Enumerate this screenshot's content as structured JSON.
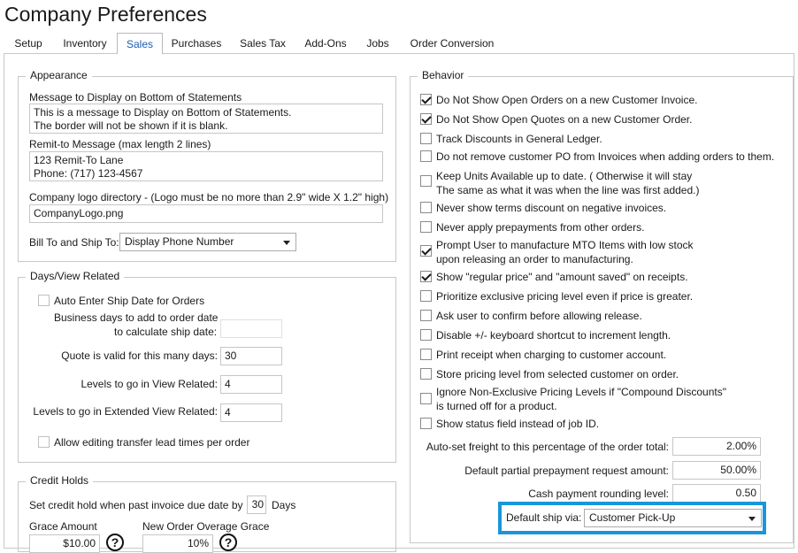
{
  "window": {
    "title": "Company Preferences"
  },
  "tabs": [
    {
      "label": "Setup"
    },
    {
      "label": "Inventory"
    },
    {
      "label": "Sales"
    },
    {
      "label": "Purchases"
    },
    {
      "label": "Sales Tax"
    },
    {
      "label": "Add-Ons"
    },
    {
      "label": "Jobs"
    },
    {
      "label": "Order Conversion"
    }
  ],
  "active_tab": "Sales",
  "appearance": {
    "title": "Appearance",
    "statement_msg_label": "Message to Display on Bottom of Statements",
    "statement_msg_line1": "This is a message to Display on Bottom of Statements.",
    "statement_msg_line2": "The border will not be shown if it is blank.",
    "remit_label": "Remit-to Message (max length 2 lines)",
    "remit_line1": "123 Remit-To Lane",
    "remit_line2": "Phone: (717) 123-4567",
    "logo_label": "Company logo directory - (Logo must be no more than 2.9\" wide X 1.2\" high)",
    "logo_value": "CompanyLogo.png",
    "billship_label": "Bill To and Ship To:",
    "billship_value": "Display Phone Number"
  },
  "days": {
    "title": "Days/View Related",
    "auto_ship_label": "Auto Enter Ship Date for Orders",
    "business_days_line1": "Business days to add to order date",
    "business_days_line2": "to calculate ship date:",
    "business_days_value": "",
    "quote_label": "Quote is valid for this many days:",
    "quote_value": "30",
    "levels_label": "Levels to go in View Related:",
    "levels_value": "4",
    "ext_levels_label": "Levels to go in Extended View Related:",
    "ext_levels_value": "4",
    "transfer_label": "Allow editing transfer lead times per order"
  },
  "credit": {
    "title": "Credit Holds",
    "set_hold_label": "Set credit hold when past invoice due date by",
    "set_hold_value": "30",
    "days_label": "Days",
    "grace_amount_label": "Grace Amount",
    "grace_amount_value": "$10.00",
    "overage_label": "New Order Overage Grace",
    "overage_value": "10%",
    "help_glyph": "?"
  },
  "behavior": {
    "title": "Behavior",
    "options": [
      {
        "line1": "Do Not Show Open Orders on a new Customer Invoice.",
        "line2": "",
        "checked": true
      },
      {
        "line1": "Do Not Show Open Quotes on a new Customer Order.",
        "line2": "",
        "checked": true
      },
      {
        "line1": "Track Discounts in General Ledger.",
        "line2": "",
        "checked": false
      },
      {
        "line1": "Do not remove customer PO from Invoices when adding orders to them.",
        "line2": "",
        "checked": false
      },
      {
        "line1": "Keep Units Available up to date. ( Otherwise it will stay",
        "line2": "The same as what it was when the line was first added.)",
        "checked": false
      },
      {
        "line1": "Never show terms discount on negative invoices.",
        "line2": "",
        "checked": false
      },
      {
        "line1": "Never apply prepayments from other orders.",
        "line2": "",
        "checked": false
      },
      {
        "line1": "Prompt User to manufacture MTO Items with low stock",
        "line2": "upon releasing an order to manufacturing.",
        "checked": true
      },
      {
        "line1": "Show \"regular price\" and \"amount saved\" on receipts.",
        "line2": "",
        "checked": true
      },
      {
        "line1": "Prioritize exclusive pricing level even if price is greater.",
        "line2": "",
        "checked": false
      },
      {
        "line1": "Ask user to confirm before allowing release.",
        "line2": "",
        "checked": false
      },
      {
        "line1": "Disable +/- keyboard shortcut to increment length.",
        "line2": "",
        "checked": false
      },
      {
        "line1": "Print receipt when charging to customer account.",
        "line2": "",
        "checked": false
      },
      {
        "line1": "Store pricing level from selected customer on order.",
        "line2": "",
        "checked": false
      },
      {
        "line1": "Ignore Non-Exclusive Pricing Levels if \"Compound Discounts\"",
        "line2": "is turned off for a product.",
        "checked": false
      },
      {
        "line1": "Show status field instead of job ID.",
        "line2": "",
        "checked": false
      }
    ],
    "freight_label": "Auto-set freight to this percentage of the order total:",
    "freight_value": "2.00%",
    "prepay_label": "Default partial prepayment request amount:",
    "prepay_value": "50.00%",
    "rounding_label": "Cash payment rounding level:",
    "rounding_value": "0.50",
    "ship_via_label": "Default ship via:",
    "ship_via_value": "Customer Pick-Up"
  },
  "colors": {
    "highlight": "#1a96d8",
    "active_tab_text": "#1a5fb4"
  }
}
